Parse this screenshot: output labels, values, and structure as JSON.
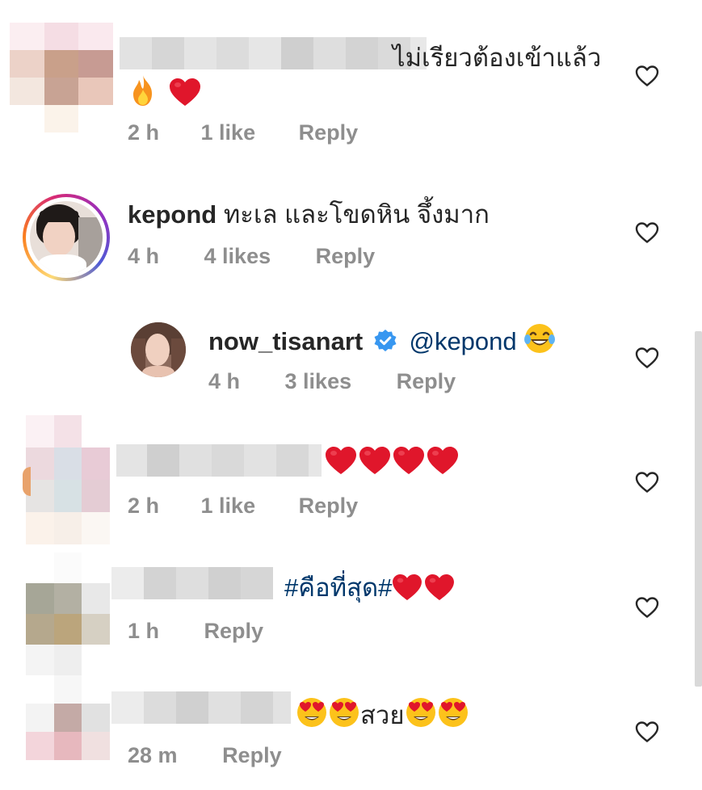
{
  "comments": [
    {
      "username": "",
      "text": "ไม่เรียวต้องเข้าแล้ว",
      "time": "2 h",
      "likes": "1 like",
      "reply": "Reply"
    },
    {
      "username": "kepond",
      "text": "ทะเล และโขดหิน จึ้งมาก",
      "time": "4 h",
      "likes": "4 likes",
      "reply": "Reply"
    },
    {
      "username": "now_tisanart",
      "verified": true,
      "mention": "@kepond",
      "time": "4 h",
      "likes": "3 likes",
      "reply": "Reply"
    },
    {
      "username": "",
      "text": "",
      "time": "2 h",
      "likes": "1 like",
      "reply": "Reply"
    },
    {
      "username": "",
      "hashtag": "#คือที่สุด#",
      "time": "1 h",
      "reply": "Reply"
    },
    {
      "username": "",
      "text": "สวย",
      "time": "28 m",
      "reply": "Reply"
    }
  ],
  "icons": {
    "like": "heart-outline-icon",
    "verified": "verified-badge-icon",
    "fire": "fire-emoji",
    "heart": "red-heart-emoji",
    "laugh": "tears-of-joy-emoji",
    "heart_eyes": "heart-eyes-emoji"
  },
  "colors": {
    "text": "#262626",
    "meta": "#8e8e8e",
    "link": "#00376b",
    "verified": "#3897f0",
    "heart": "#ed1c24"
  }
}
